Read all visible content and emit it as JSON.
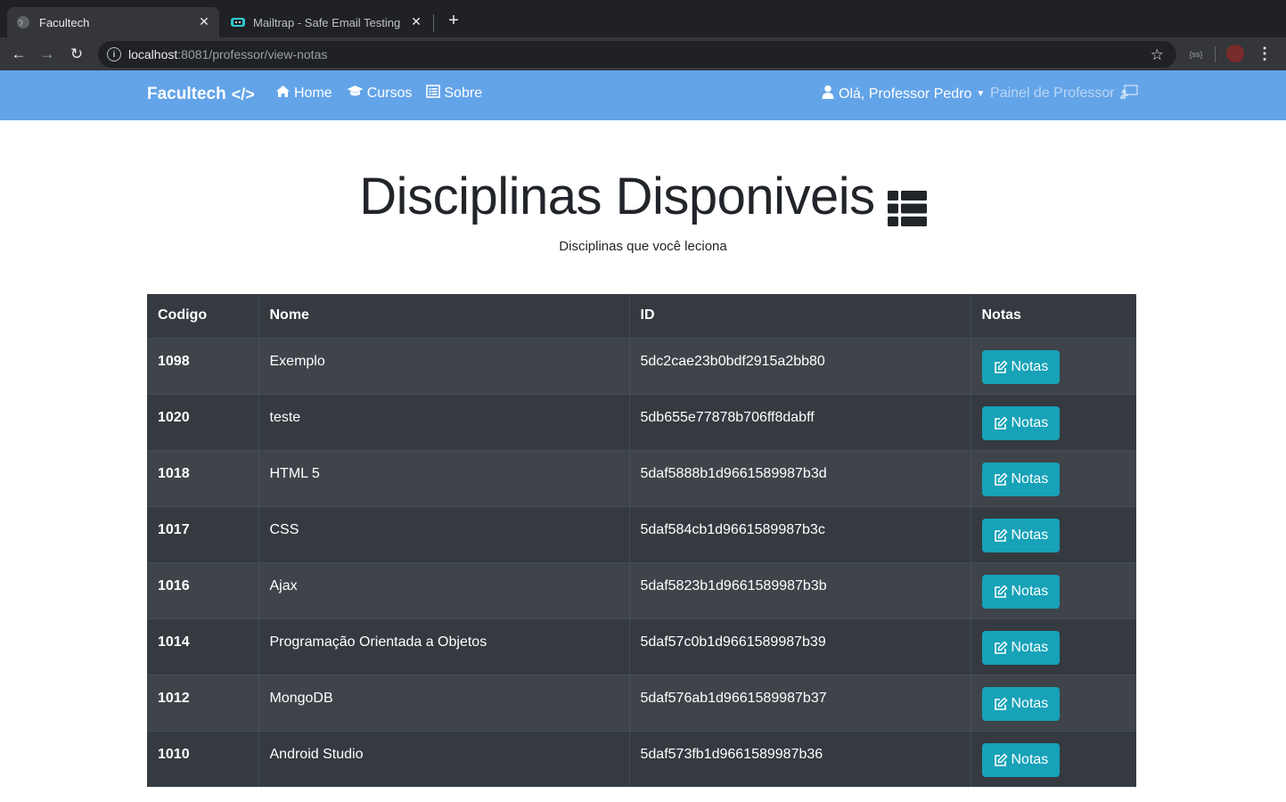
{
  "browser": {
    "tabs": [
      {
        "title": "Facultech",
        "active": true
      },
      {
        "title": "Mailtrap - Safe Email Testing",
        "active": false
      }
    ],
    "url_host": "localhost",
    "url_path": ":8081/professor/view-notas",
    "extension_label": "{ss}"
  },
  "navbar": {
    "brand": "Facultech",
    "links": [
      {
        "label": "Home",
        "icon": "home-icon"
      },
      {
        "label": "Cursos",
        "icon": "graduation-cap-icon"
      },
      {
        "label": "Sobre",
        "icon": "list-alt-icon"
      }
    ],
    "user_greeting": "Olá, Professor Pedro",
    "panel_label": "Painel de Professor",
    "color": "#63a4e8"
  },
  "hero": {
    "title": "Disciplinas Disponiveis",
    "subtitle": "Disciplinas que você leciona"
  },
  "table": {
    "headers": [
      "Codigo",
      "Nome",
      "ID",
      "Notas"
    ],
    "button_label": "Notas",
    "rows": [
      {
        "codigo": "1098",
        "nome": "Exemplo",
        "id": "5dc2cae23b0bdf2915a2bb80"
      },
      {
        "codigo": "1020",
        "nome": "teste",
        "id": "5db655e77878b706ff8dabff"
      },
      {
        "codigo": "1018",
        "nome": "HTML 5",
        "id": "5daf5888b1d9661589987b3d"
      },
      {
        "codigo": "1017",
        "nome": "CSS",
        "id": "5daf584cb1d9661589987b3c"
      },
      {
        "codigo": "1016",
        "nome": "Ajax",
        "id": "5daf5823b1d9661589987b3b"
      },
      {
        "codigo": "1014",
        "nome": "Programação Orientada a Objetos",
        "id": "5daf57c0b1d9661589987b39"
      },
      {
        "codigo": "1012",
        "nome": "MongoDB",
        "id": "5daf576ab1d9661589987b37"
      },
      {
        "codigo": "1010",
        "nome": "Android Studio",
        "id": "5daf573fb1d9661589987b36"
      }
    ],
    "button_color": "#17a2b8"
  }
}
